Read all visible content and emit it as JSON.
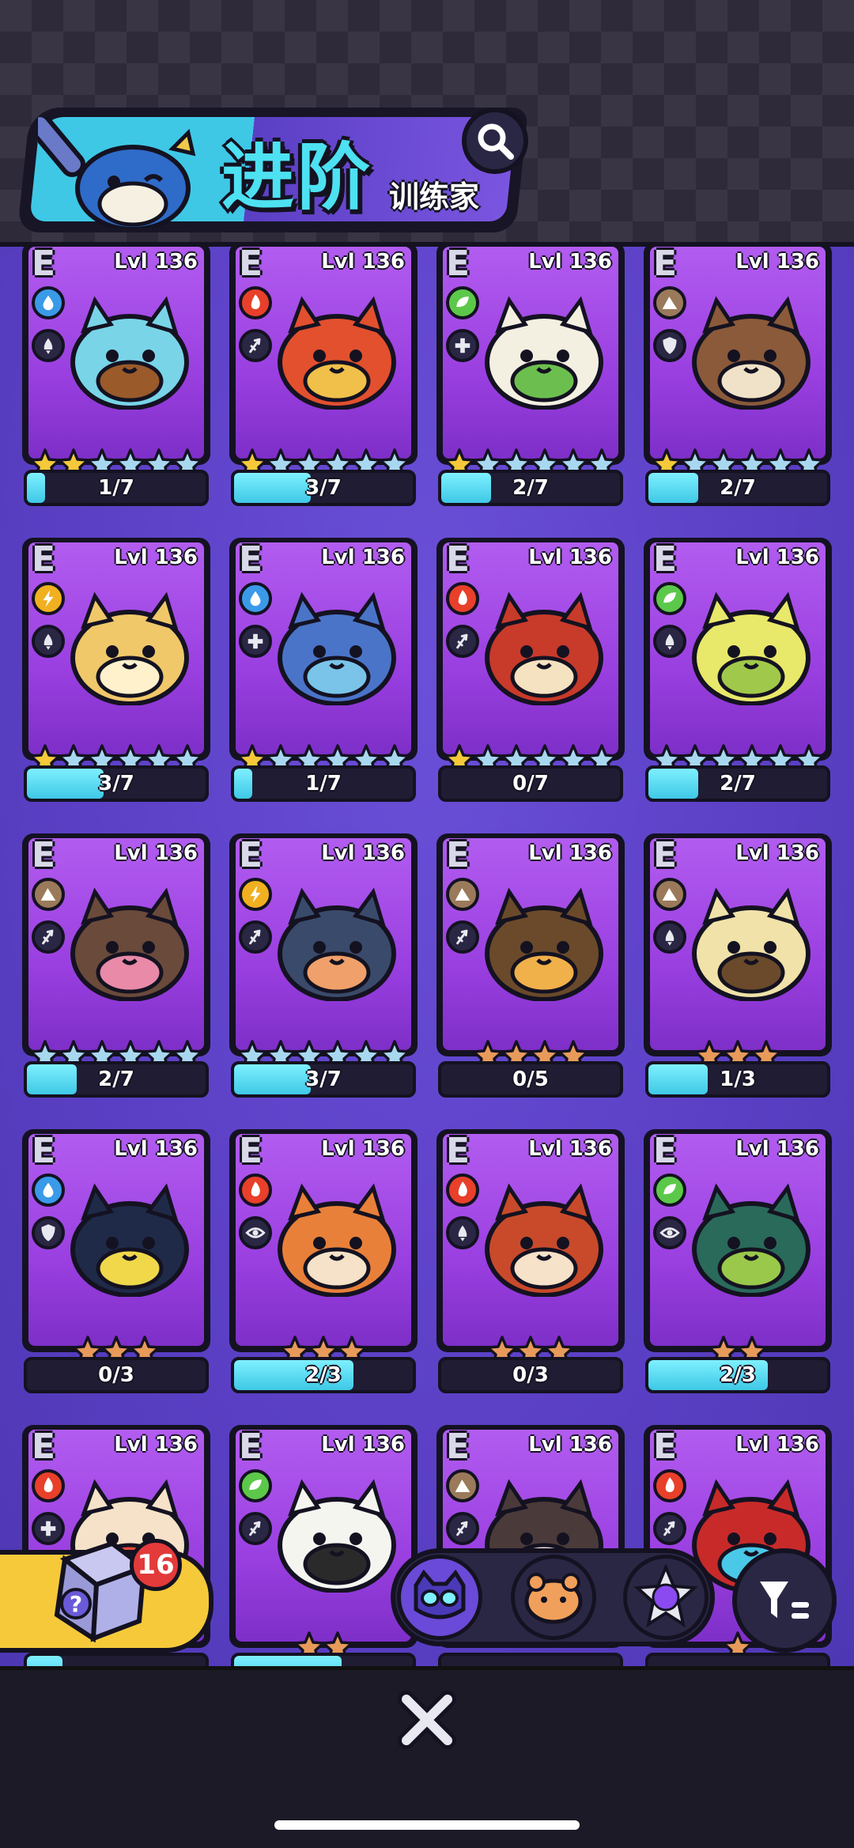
{
  "header": {
    "title": "进阶",
    "subtitle": "训练家"
  },
  "cards": [
    {
      "grade": "E",
      "level": "Lvl 136",
      "element": "water",
      "role": "drop",
      "stars_filled": 2,
      "stars_total": 6,
      "star_style": "gold",
      "progress": "1/7",
      "fraction": 0.1,
      "body": "#79d4e8",
      "accent": "#9a5a2a"
    },
    {
      "grade": "E",
      "level": "Lvl 136",
      "element": "fire",
      "role": "dash",
      "stars_filled": 1,
      "stars_total": 6,
      "star_style": "gold",
      "progress": "3/7",
      "fraction": 0.43,
      "body": "#e2502e",
      "accent": "#f0c04a"
    },
    {
      "grade": "E",
      "level": "Lvl 136",
      "element": "grass",
      "role": "heal",
      "stars_filled": 1,
      "stars_total": 6,
      "star_style": "gold",
      "progress": "2/7",
      "fraction": 0.28,
      "body": "#f3f0e2",
      "accent": "#6cbf4e"
    },
    {
      "grade": "E",
      "level": "Lvl 136",
      "element": "ground",
      "role": "shield",
      "stars_filled": 1,
      "stars_total": 6,
      "star_style": "gold",
      "progress": "2/7",
      "fraction": 0.28,
      "body": "#8a5a3a",
      "accent": "#f0e2c8"
    },
    {
      "grade": "E",
      "level": "Lvl 136",
      "element": "electric",
      "role": "drop",
      "stars_filled": 1,
      "stars_total": 6,
      "star_style": "gold",
      "progress": "3/7",
      "fraction": 0.43,
      "body": "#f0c86a",
      "accent": "#fff1cc"
    },
    {
      "grade": "E",
      "level": "Lvl 136",
      "element": "water",
      "role": "heal",
      "stars_filled": 1,
      "stars_total": 6,
      "star_style": "gold",
      "progress": "1/7",
      "fraction": 0.1,
      "body": "#4a74c8",
      "accent": "#79c4e8"
    },
    {
      "grade": "E",
      "level": "Lvl 136",
      "element": "fire",
      "role": "dash",
      "stars_filled": 1,
      "stars_total": 6,
      "star_style": "gold",
      "progress": "0/7",
      "fraction": 0,
      "body": "#c83a2a",
      "accent": "#f5e2c0"
    },
    {
      "grade": "E",
      "level": "Lvl 136",
      "element": "grass",
      "role": "drop",
      "stars_filled": 0,
      "stars_total": 6,
      "star_style": "gold",
      "progress": "2/7",
      "fraction": 0.28,
      "body": "#e8e86a",
      "accent": "#a0c84a"
    },
    {
      "grade": "E",
      "level": "Lvl 136",
      "element": "ground",
      "role": "dash",
      "stars_filled": 0,
      "stars_total": 6,
      "star_style": "gold",
      "progress": "2/7",
      "fraction": 0.28,
      "body": "#6a4a3a",
      "accent": "#e88aa8"
    },
    {
      "grade": "E",
      "level": "Lvl 136",
      "element": "electric",
      "role": "dash",
      "stars_filled": 0,
      "stars_total": 6,
      "star_style": "gold",
      "progress": "3/7",
      "fraction": 0.43,
      "body": "#3a4a6a",
      "accent": "#f0a06a"
    },
    {
      "grade": "E",
      "level": "Lvl 136",
      "element": "ground",
      "role": "dash",
      "stars_filled": 4,
      "stars_total": 4,
      "star_style": "bronze",
      "progress": "0/5",
      "fraction": 0,
      "body": "#6a4a2a",
      "accent": "#f0b04a"
    },
    {
      "grade": "E",
      "level": "Lvl 136",
      "element": "ground",
      "role": "drop",
      "stars_filled": 3,
      "stars_total": 3,
      "star_style": "bronze",
      "progress": "1/3",
      "fraction": 0.33,
      "body": "#f0e2a8",
      "accent": "#6a4a2a"
    },
    {
      "grade": "E",
      "level": "Lvl 136",
      "element": "water",
      "role": "shield",
      "stars_filled": 3,
      "stars_total": 3,
      "star_style": "bronze",
      "progress": "0/3",
      "fraction": 0,
      "body": "#1f2a48",
      "accent": "#f0d84a"
    },
    {
      "grade": "E",
      "level": "Lvl 136",
      "element": "fire",
      "role": "target",
      "stars_filled": 3,
      "stars_total": 3,
      "star_style": "bronze",
      "progress": "2/3",
      "fraction": 0.67,
      "body": "#e8803a",
      "accent": "#f5e2c8"
    },
    {
      "grade": "E",
      "level": "Lvl 136",
      "element": "fire",
      "role": "drop",
      "stars_filled": 3,
      "stars_total": 3,
      "star_style": "bronze",
      "progress": "0/3",
      "fraction": 0,
      "body": "#c84a2a",
      "accent": "#f5e2c8"
    },
    {
      "grade": "E",
      "level": "Lvl 136",
      "element": "grass",
      "role": "target",
      "stars_filled": 2,
      "stars_total": 2,
      "star_style": "bronze",
      "progress": "2/3",
      "fraction": 0.67,
      "body": "#2a6a5a",
      "accent": "#9ac84a"
    },
    {
      "grade": "E",
      "level": "Lvl 136",
      "element": "fire",
      "role": "heal",
      "stars_filled": 0,
      "stars_total": 0,
      "star_style": "bronze",
      "progress": "",
      "fraction": 0.2,
      "body": "#f5e2c8",
      "accent": "#e84a3a"
    },
    {
      "grade": "E",
      "level": "Lvl 136",
      "element": "grass",
      "role": "dash",
      "stars_filled": 2,
      "stars_total": 2,
      "star_style": "bronze",
      "progress": "",
      "fraction": 0.6,
      "body": "#f5f5f0",
      "accent": "#2a2a2a"
    },
    {
      "grade": "E",
      "level": "Lvl 136",
      "element": "ground",
      "role": "dash",
      "stars_filled": 0,
      "stars_total": 0,
      "star_style": "bronze",
      "progress": "",
      "fraction": 0,
      "body": "#4a3a3a",
      "accent": "#f5e2e2"
    },
    {
      "grade": "E",
      "level": "Lvl 136",
      "element": "fire",
      "role": "dash",
      "stars_filled": 1,
      "stars_total": 1,
      "star_style": "bronze",
      "progress": "",
      "fraction": 0,
      "body": "#c82a2a",
      "accent": "#4ac8e8"
    }
  ],
  "capsule": {
    "count": "16"
  },
  "colors": {
    "water": "#3a9ae8",
    "fire": "#e8402a",
    "grass": "#5cc84a",
    "ground": "#9a7a5a",
    "electric": "#f0b020"
  }
}
